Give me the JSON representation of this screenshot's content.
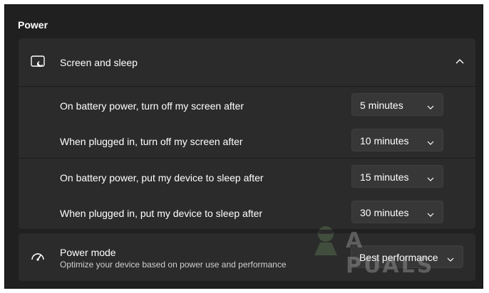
{
  "section": {
    "title": "Power"
  },
  "screen_sleep": {
    "title": "Screen and sleep",
    "icon": "screen-sleep-icon",
    "expanded": true,
    "settings": [
      {
        "label": "On battery power, turn off my screen after",
        "value": "5 minutes"
      },
      {
        "label": "When plugged in, turn off my screen after",
        "value": "10 minutes"
      },
      {
        "label": "On battery power, put my device to sleep after",
        "value": "15 minutes"
      },
      {
        "label": "When plugged in, put my device to sleep after",
        "value": "30 minutes"
      }
    ]
  },
  "power_mode": {
    "title": "Power mode",
    "description": "Optimize your device based on power use and performance",
    "value": "Best performance",
    "icon": "gauge-icon"
  },
  "watermark": {
    "text": "A  PUALS"
  },
  "colors": {
    "background": "#202020",
    "card": "#2b2b2b",
    "combo": "#373737",
    "text": "#ffffff",
    "secondary_text": "#cfcfcf"
  }
}
